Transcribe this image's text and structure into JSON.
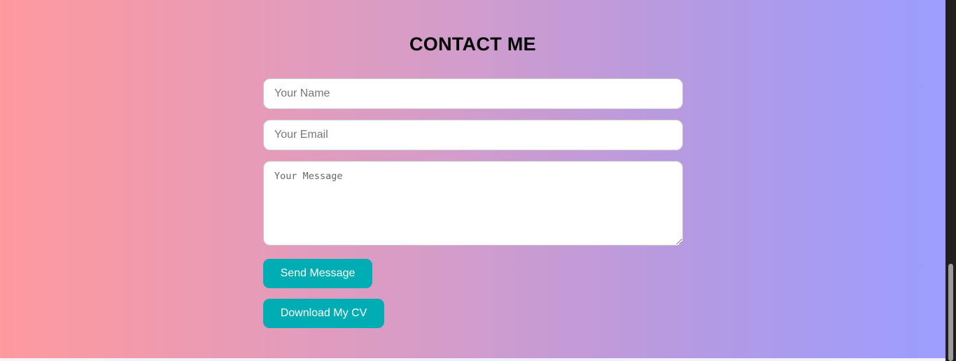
{
  "contact": {
    "title": "CONTACT ME",
    "name_placeholder": "Your Name",
    "email_placeholder": "Your Email",
    "message_placeholder": "Your Message",
    "send_label": "Send Message",
    "cv_label": "Download My CV"
  },
  "colors": {
    "gradient_start": "#ff9a9e",
    "gradient_end": "#9b9dff",
    "button": "#00adb5"
  }
}
